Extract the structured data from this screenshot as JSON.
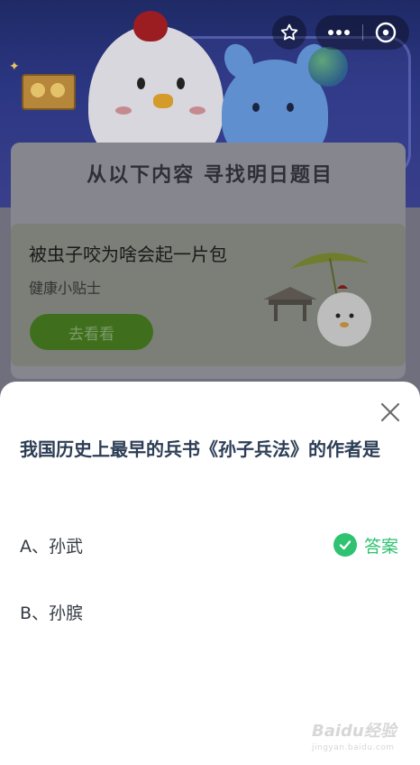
{
  "background": {
    "banner_heading": "从以下内容 寻找明日题目",
    "tip_card": {
      "title": "被虫子咬为啥会起一片包",
      "subtitle": "健康小贴士",
      "button_label": "去看看"
    }
  },
  "top_actions": {
    "favorite_icon": "star-outline-icon",
    "more_icon": "more-dots-icon",
    "close_icon": "close-circle-icon"
  },
  "sheet": {
    "question": "我国历史上最早的兵书《孙子兵法》的作者是",
    "options": [
      {
        "label": "A、孙武",
        "is_answer": true
      },
      {
        "label": "B、孙膑",
        "is_answer": false
      }
    ],
    "answer_label": "答案",
    "close_icon": "close-icon"
  },
  "watermark": {
    "brand": "Baidu经验",
    "url": "jingyan.baidu.com"
  },
  "colors": {
    "answer_green": "#2fc271",
    "question_text": "#2c3d55",
    "overlay_dim": "#6f6f7e"
  }
}
